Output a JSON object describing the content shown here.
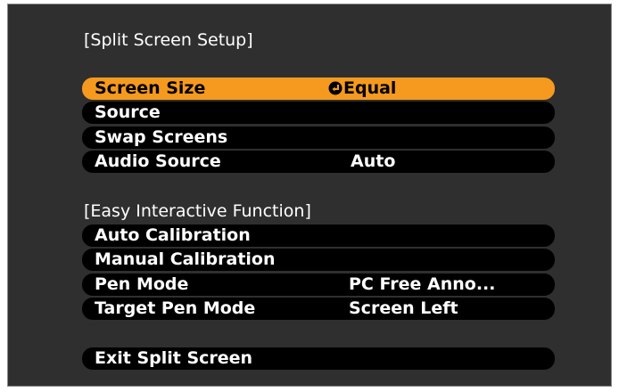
{
  "sections": {
    "split_screen_title": "[Split Screen Setup]",
    "easy_interactive_title": "[Easy Interactive Function]"
  },
  "split_items": [
    {
      "label": "Screen Size",
      "value": "Equal"
    },
    {
      "label": "Source",
      "value": ""
    },
    {
      "label": "Swap Screens",
      "value": ""
    },
    {
      "label": "Audio Source",
      "value": "Auto"
    }
  ],
  "interactive_items": [
    {
      "label": "Auto Calibration",
      "value": ""
    },
    {
      "label": "Manual Calibration",
      "value": ""
    },
    {
      "label": "Pen Mode",
      "value": "PC Free Anno..."
    },
    {
      "label": "Target Pen Mode",
      "value": "Screen Left"
    }
  ],
  "exit_label": "Exit Split Screen",
  "icons": {
    "selected_value_icon": "enter-icon"
  },
  "colors": {
    "background": "#2f2f2f",
    "row": "#000000",
    "highlight": "#f59a1f",
    "text": "#ffffff"
  }
}
